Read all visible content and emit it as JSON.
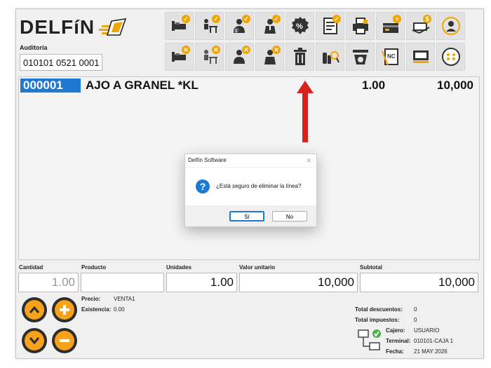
{
  "app": {
    "name": "DELFíN"
  },
  "auditoria": {
    "label": "Auditoría",
    "value": "010101 0521 0001"
  },
  "toolbar": {
    "row1": [
      "bed-check-icon",
      "desk-check-icon",
      "cashier-check-icon",
      "waiter-check-icon",
      "discount-icon",
      "document-check-icon",
      "printer-icon",
      "card-add-icon",
      "cash-pay-icon",
      "user-refresh-icon"
    ],
    "row2": [
      "bed-close-icon",
      "desk-close-icon",
      "cashier-close-icon",
      "waiter-close-icon",
      "trash-icon",
      "product-search-icon",
      "scale-icon",
      "credit-note-icon",
      "cash-register-icon",
      "more-options-icon"
    ]
  },
  "grid": {
    "rows": [
      {
        "code": "000001",
        "product": "AJO A GRANEL *KL",
        "qty": "1.00",
        "amount": "10,000"
      }
    ]
  },
  "dialog": {
    "title": "Delfín Software",
    "close": "✕",
    "message": "¿Está seguro de eliminar la línea?",
    "icon": "?",
    "yes": "Sí",
    "no": "No"
  },
  "entry": {
    "labels": {
      "cantidad": "Cantidad",
      "producto": "Producto",
      "unidades": "Unidades",
      "valor": "Valor unitario",
      "subtotal": "Subtotal"
    },
    "values": {
      "cantidad": "1.00",
      "producto": "",
      "unidades": "1.00",
      "valor": "10,000",
      "subtotal": "10,000"
    }
  },
  "product_info": {
    "precio_label": "Precio:",
    "precio_value": "VENTA1",
    "existencia_label": "Existencia:",
    "existencia_value": "0.00"
  },
  "totals": {
    "desc_label": "Total descuentos:",
    "desc_value": "0",
    "imp_label": "Total impuestos:",
    "imp_value": "0"
  },
  "session": {
    "cajero_label": "Cajero:",
    "cajero_value": "USUARIO",
    "terminal_label": "Terminal:",
    "terminal_value": "010101-CAJA 1",
    "fecha_label": "Fecha:",
    "fecha_value": "21 MAY 2026"
  },
  "colors": {
    "accent": "#1f78d1",
    "brand_orange": "#f0a500",
    "arrow": "#d9211d"
  }
}
